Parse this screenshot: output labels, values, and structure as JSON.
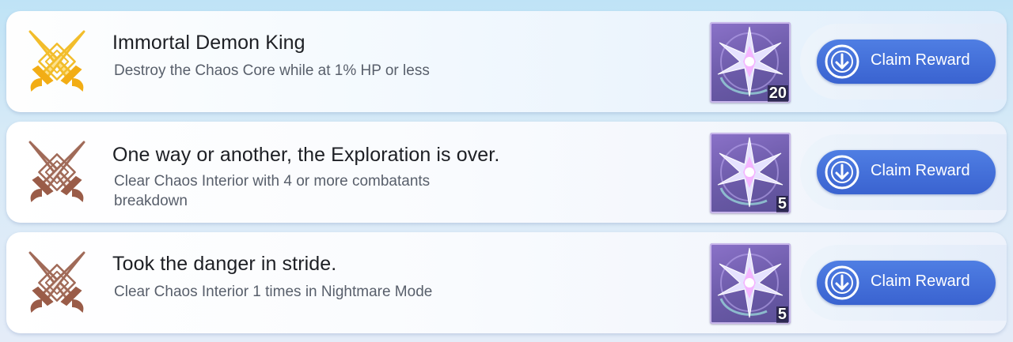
{
  "achievements": [
    {
      "title": "Immortal Demon King",
      "description": "Destroy the Chaos Core while at 1% HP or less",
      "status_icon": "crossed-swords-icon-gold",
      "accent_color": "#f2bd2b",
      "reward_icon": "crystal-star-icon",
      "reward_quantity": "20",
      "button_icon": "download-circle-icon",
      "button_label": "Claim Reward"
    },
    {
      "title": "One way or another, the Exploration is over.",
      "description": "Clear Chaos Interior with 4 or more combatants breakdown",
      "status_icon": "crossed-swords-icon-bronze",
      "accent_color": "#a06a58",
      "reward_icon": "crystal-star-icon",
      "reward_quantity": "5",
      "button_icon": "download-circle-icon",
      "button_label": "Claim Reward"
    },
    {
      "title": "Took the danger in stride.",
      "description": "Clear Chaos Interior 1 times in Nightmare Mode",
      "status_icon": "crossed-swords-icon-bronze",
      "accent_color": "#a06a58",
      "reward_icon": "crystal-star-icon",
      "reward_quantity": "5",
      "button_icon": "download-circle-icon",
      "button_label": "Claim Reward"
    }
  ],
  "colors": {
    "button": "#4170d8",
    "reward_frame": "#6b5aa8",
    "gold": "#f2bd2b",
    "bronze": "#a06a58"
  }
}
